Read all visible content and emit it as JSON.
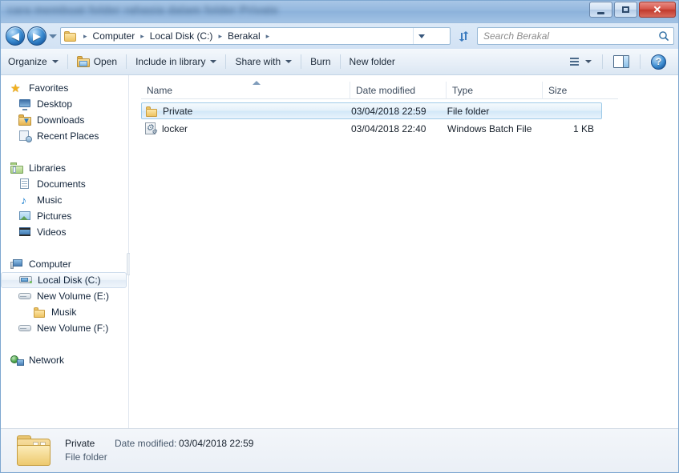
{
  "window": {
    "title": "cara membuat folder rahasia dalam folder Private",
    "controls": {
      "minimize": "Minimize",
      "maximize": "Maximize",
      "close": "Close",
      "close_glyph": "✕"
    }
  },
  "nav": {
    "back": "◀",
    "forward": "▶",
    "recent_pages_tooltip": "Recent Pages",
    "refresh": "Refresh",
    "breadcrumbs": [
      "Computer",
      "Local Disk (C:)",
      "Berakal"
    ],
    "separator": "▸"
  },
  "search": {
    "placeholder": "Search Berakal",
    "icon": "search-icon"
  },
  "toolbar": {
    "organize": "Organize",
    "open": "Open",
    "include_in_library": "Include in library",
    "share_with": "Share with",
    "burn": "Burn",
    "new_folder": "New folder",
    "help": "?"
  },
  "sidebar": {
    "groups": [
      {
        "root": {
          "label": "Favorites",
          "icon": "star-icon"
        },
        "items": [
          {
            "label": "Desktop",
            "icon": "desktop-icon"
          },
          {
            "label": "Downloads",
            "icon": "downloads-folder-icon"
          },
          {
            "label": "Recent Places",
            "icon": "recent-places-icon"
          }
        ]
      },
      {
        "root": {
          "label": "Libraries",
          "icon": "libraries-icon"
        },
        "items": [
          {
            "label": "Documents",
            "icon": "documents-icon"
          },
          {
            "label": "Music",
            "icon": "music-note-icon"
          },
          {
            "label": "Pictures",
            "icon": "pictures-icon"
          },
          {
            "label": "Videos",
            "icon": "videos-icon"
          }
        ]
      },
      {
        "root": {
          "label": "Computer",
          "icon": "computer-icon"
        },
        "items": [
          {
            "label": "Local Disk (C:)",
            "icon": "hard-disk-icon",
            "selected": true
          },
          {
            "label": "New Volume (E:)",
            "icon": "drive-icon"
          },
          {
            "label": "Musik",
            "icon": "folder-icon",
            "child": true
          },
          {
            "label": "New Volume (F:)",
            "icon": "drive-icon"
          }
        ]
      },
      {
        "root": {
          "label": "Network",
          "icon": "network-icon"
        },
        "items": []
      }
    ]
  },
  "filelist": {
    "columns": [
      "Name",
      "Date modified",
      "Type",
      "Size"
    ],
    "sort_column": "Name",
    "sort_direction": "ascending",
    "rows": [
      {
        "name": "Private",
        "date_modified": "03/04/2018 22:59",
        "type": "File folder",
        "size": "",
        "icon": "folder-icon",
        "selected": true
      },
      {
        "name": "locker",
        "date_modified": "03/04/2018 22:40",
        "type": "Windows Batch File",
        "size": "1 KB",
        "icon": "batch-file-icon",
        "selected": false
      }
    ]
  },
  "details": {
    "name": "Private",
    "date_modified_label": "Date modified:",
    "date_modified_value": "03/04/2018 22:59",
    "type": "File folder",
    "icon": "large-folder-icon"
  }
}
